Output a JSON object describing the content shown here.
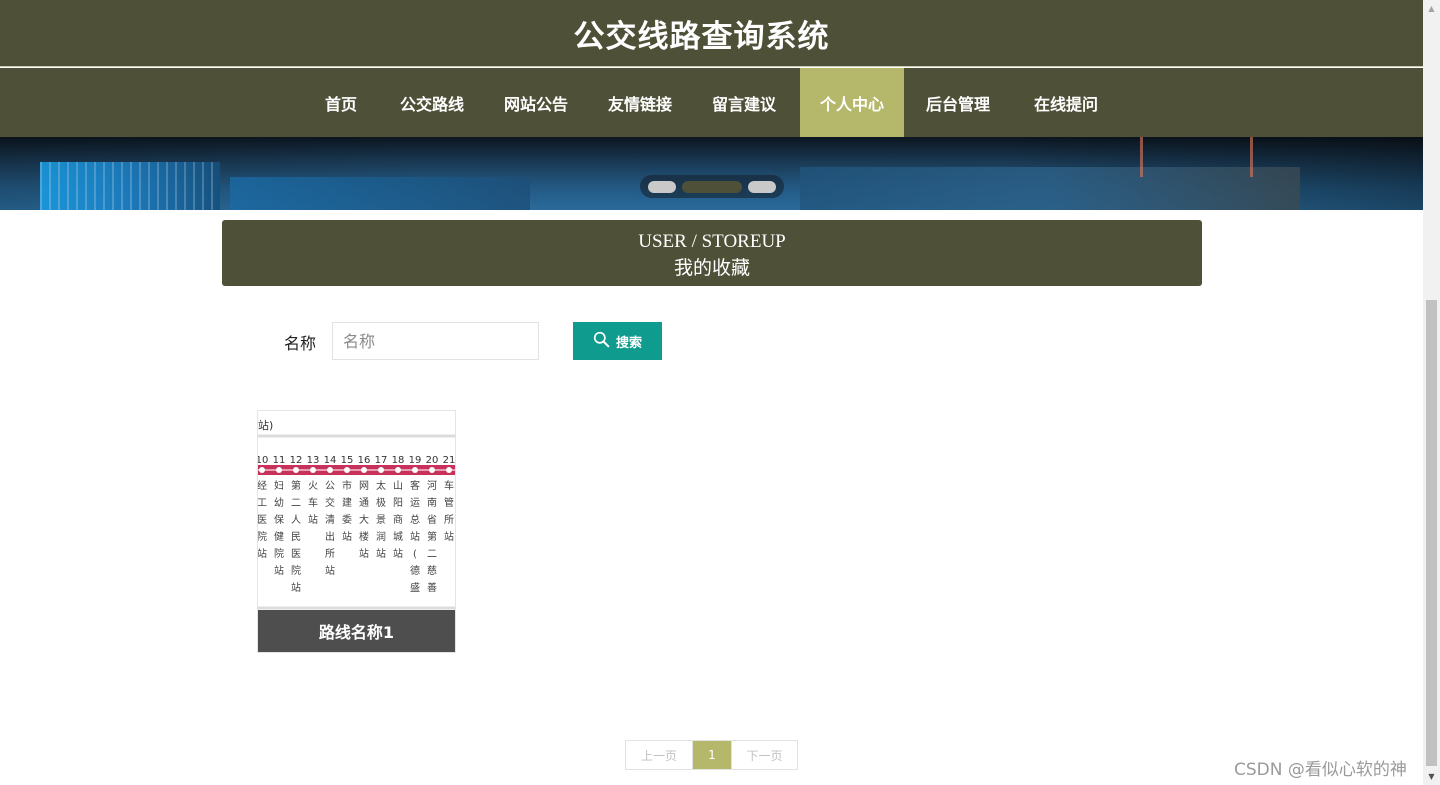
{
  "header": {
    "title": "公交线路查询系统"
  },
  "nav": [
    {
      "label": "首页",
      "active": false
    },
    {
      "label": "公交路线",
      "active": false
    },
    {
      "label": "网站公告",
      "active": false
    },
    {
      "label": "友情链接",
      "active": false
    },
    {
      "label": "留言建议",
      "active": false
    },
    {
      "label": "个人中心",
      "active": true
    },
    {
      "label": "后台管理",
      "active": false
    },
    {
      "label": "在线提问",
      "active": false
    }
  ],
  "carousel": {
    "slide_count": 3,
    "active_index": 1
  },
  "section": {
    "title_en": "USER / STOREUP",
    "title_cn": "我的收藏"
  },
  "search": {
    "label": "名称",
    "placeholder": "名称",
    "value": "",
    "button_label": "搜索"
  },
  "cards": [
    {
      "caption": "路线名称1",
      "image": {
        "header_text": "站)",
        "stop_numbers": [
          "10",
          "11",
          "12",
          "13",
          "14",
          "15",
          "16",
          "17",
          "18",
          "19",
          "20",
          "21"
        ],
        "stop_names": [
          "经工医院站",
          "妇幼保健院站",
          "第二人民医院站",
          "火车站",
          "公交清出所站",
          "市建委站",
          "网通大楼站",
          "太极景润站",
          "山阳商城站",
          "客运总站(德盛汽",
          "河南省第二慈善",
          "车管所站"
        ]
      }
    }
  ],
  "pagination": {
    "prev": "上一页",
    "current": "1",
    "next": "下一页"
  },
  "watermark": "CSDN @看似心软的神",
  "colors": {
    "header_bg": "#4f5038",
    "nav_active": "#b5b86a",
    "search_button": "#0f9b8e",
    "card_caption_bg": "#4e4e4e",
    "route_line": "#c8325a"
  }
}
